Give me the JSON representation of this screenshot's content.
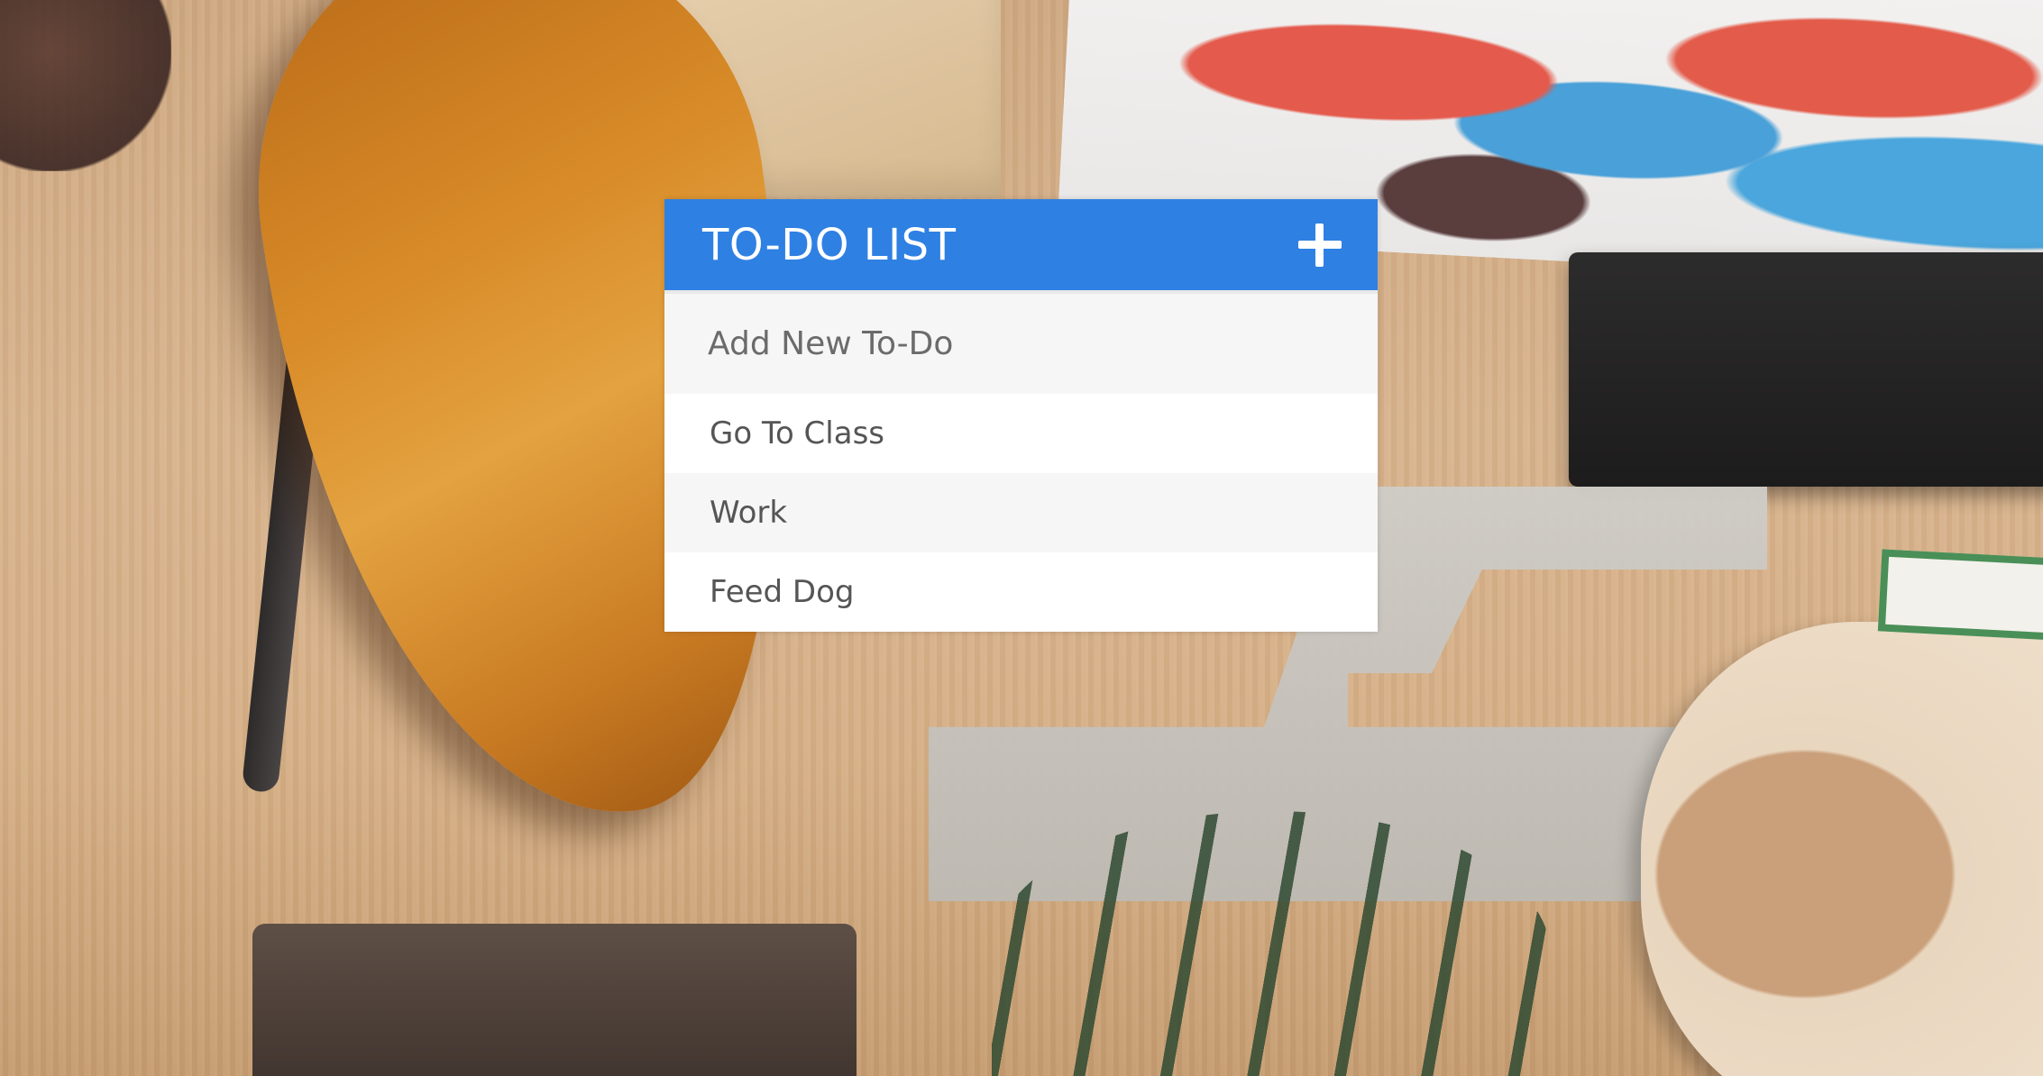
{
  "header": {
    "title": "TO-DO LIST",
    "add_icon": "plus-icon"
  },
  "new_todo": {
    "placeholder": "Add New To-Do",
    "value": ""
  },
  "todos": [
    {
      "label": "Go To Class"
    },
    {
      "label": "Work"
    },
    {
      "label": "Feed Dog"
    }
  ],
  "colors": {
    "header_background": "#2f80e3",
    "header_text": "#ffffff",
    "input_background": "#f6f6f6",
    "item_text": "#555555"
  }
}
